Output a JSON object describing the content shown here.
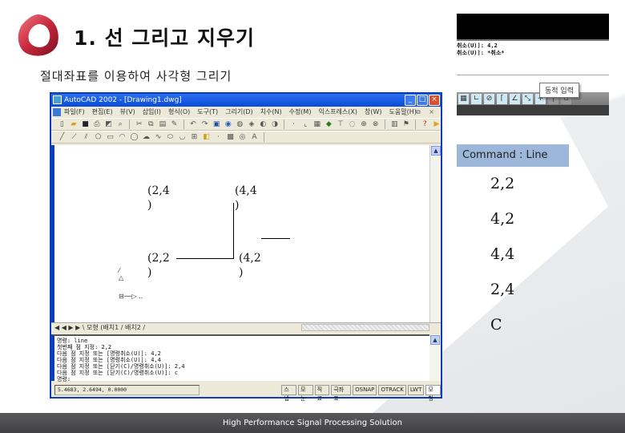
{
  "slide": {
    "title": "1. 선 그리고 지우기",
    "subtitle": "절대좌표를 이용하여 사각형 그리기",
    "footer": "High Performance Signal Processing Solution",
    "colors": {
      "accent": "#c8283c",
      "footer_bg": "#4a4a4c",
      "command_box": "#9db7db",
      "xp_blue": "#0a4ad8"
    }
  },
  "autocad": {
    "title": "AutoCAD 2002 - [Drawing1.dwg]",
    "window_buttons": [
      "_",
      "□",
      "×"
    ],
    "menu": [
      "파일(F)",
      "편집(E)",
      "뷰(V)",
      "삽입(I)",
      "형식(O)",
      "도구(T)",
      "그리기(D)",
      "치수(N)",
      "수정(M)",
      "익스프레스(X)",
      "창(W)",
      "도움말(H)"
    ],
    "mdi_buttons": "_ ⧉ ×",
    "standard_toolbar": [
      "new-icon",
      "open-icon",
      "save-icon",
      "print-icon",
      "preview-icon",
      "publish-icon",
      "cut-icon",
      "copy-icon",
      "paste-icon",
      "matchprop-icon",
      "undo-icon",
      "redo-icon",
      "hyperlink-icon",
      "ucs-icon",
      "tracking-icon",
      "osnap-icon",
      "zoom-icon",
      "pan-icon",
      "zoom-realtime-icon",
      "zoom-window-icon",
      "zoom-previous-icon",
      "properties-icon",
      "designcenter-icon",
      "help-icon",
      "today-icon"
    ],
    "draw_toolbar": [
      "line-icon",
      "xline-icon",
      "pline-icon",
      "polygon-icon",
      "rectangle-icon",
      "arc-icon",
      "circle-icon",
      "revcloud-icon",
      "spline-icon",
      "ellipse-icon",
      "ellipse-arc-icon",
      "insert-block-icon",
      "make-block-icon",
      "point-icon",
      "hatch-icon",
      "region-icon",
      "text-icon"
    ],
    "drawing_labels": [
      "(2,4\n)",
      "(4,4\n)",
      "(2,2\n)",
      "(4,2\n)"
    ],
    "layout_tabs": "◀ ◀ ▶ ▶ \\ 모형 (배치1 / 배치2 /",
    "command_history": [
      "명령: line",
      "첫번째 점 지정: 2,2",
      "다음 점 지정 또는 [명령취소(U)]: 4,2",
      "다음 점 지정 또는 [명령취소(U)]: 4,4",
      "다음 점 지정 또는 [닫기(C)/명령취소(U)]: 2,4",
      "다음 점 지정 또는 [닫기(C)/명령취소(U)]: c",
      "명령:"
    ],
    "status": {
      "coords": "5.4683, 2.6494, 0.0000",
      "buttons": [
        "스냅",
        "모눈",
        "직교",
        "극좌표",
        "OSNAP",
        "OTRACK",
        "LWT",
        "모형"
      ]
    }
  },
  "right_panel": {
    "undo_lines": [
      "취소(U)]: 4,2",
      "취소(U)]: *취소*"
    ],
    "tooltip": "동적 입력",
    "dyn_toolbar": [
      "grid-icon",
      "ortho-icon",
      "polar-icon",
      "osnap-icon",
      "otrack-icon",
      "ducs-icon",
      "dyn-icon",
      "lwt-icon",
      "model-icon"
    ],
    "command_label": "Command : Line",
    "steps": [
      "2,2",
      "4,2",
      "4,4",
      "2,4",
      "C"
    ]
  }
}
